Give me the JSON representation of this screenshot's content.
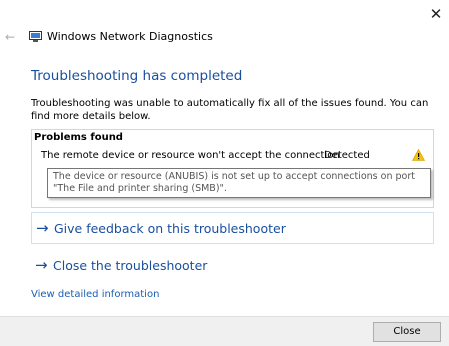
{
  "window": {
    "title": "Windows Network Diagnostics",
    "close_glyph": "✕",
    "back_glyph": "←"
  },
  "main": {
    "heading": "Troubleshooting has completed",
    "description": "Troubleshooting was unable to automatically fix all of the issues found. You can find more details below."
  },
  "problems": {
    "header": "Problems found",
    "items": [
      {
        "text": "The remote device or resource won't accept the connection",
        "status": "Detected",
        "icon": "warning-icon"
      }
    ],
    "tooltip": "The device or resource (ANUBIS) is not set up to accept connections on port \"The File and printer sharing (SMB)\"."
  },
  "actions": {
    "arrow_glyph": "→",
    "feedback_label": "Give feedback on this troubleshooter",
    "close_label": "Close the troubleshooter",
    "details_link": "View detailed information"
  },
  "footer": {
    "close_button": "Close"
  },
  "colors": {
    "accent": "#1a4fa0",
    "link": "#1a5fb4",
    "warning": "#f5c400"
  }
}
